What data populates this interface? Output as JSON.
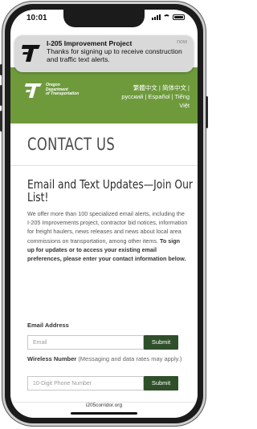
{
  "status_bar": {
    "time": "10:01"
  },
  "notification": {
    "title": "I-205 Improvement Project",
    "time": "now",
    "body": "Thanks for signing up to receive construction and traffic text alerts."
  },
  "header": {
    "logo_lines": [
      "Oregon",
      "Department",
      "of Transportation"
    ],
    "languages": [
      "繁體中文 |",
      "简体中文 |",
      "русский |",
      "Español |",
      "Tiếng",
      "Việt"
    ]
  },
  "page": {
    "title": "CONTACT US",
    "section_title_line1": "Email and Text Updates—Join Our",
    "section_title_line2": "List!",
    "description_plain": "We offer more than 100 specialized email alerts, including the I-205 Improvements project, contractor bid notices, information for freight haulers, news releases and news about local area commissions on transportation, among other items.",
    "description_bold": "To sign up for updates or to access your existing email preferences, please enter your contact information below."
  },
  "email_form": {
    "label": "Email Address",
    "placeholder": "Email",
    "submit_label": "Submit"
  },
  "phone_form": {
    "label": "Wireless Number",
    "label_note": "(Messaging and data rates may apply.)",
    "placeholder": "10-Digit Phone Number",
    "submit_label": "Submit"
  },
  "browser": {
    "url": "i205corridor.org"
  },
  "colors": {
    "header_green": "#6e9a3c",
    "button_green": "#2f4f2a",
    "notification_bg": "#d9d9d9"
  }
}
